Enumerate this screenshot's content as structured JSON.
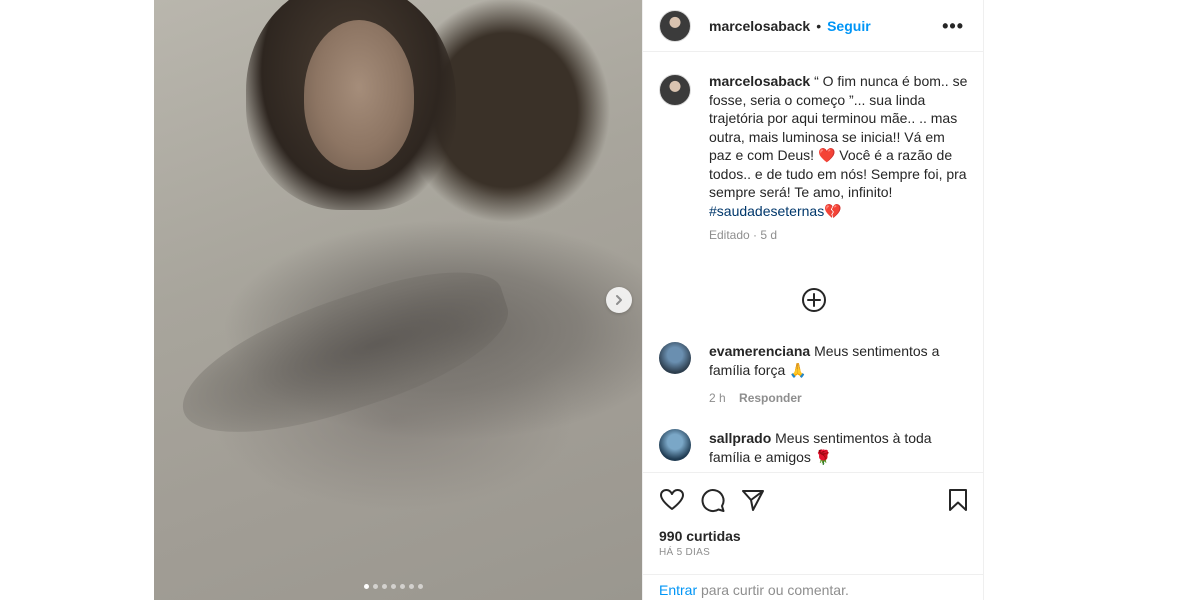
{
  "post": {
    "author": "marcelosaback",
    "follow_label": "Seguir",
    "separator": "•",
    "more_label": "•••",
    "caption": {
      "text": "“ O fim nunca é bom.. se fosse, seria o começo ”... sua linda trajetória por aqui terminou mãe.. .. mas outra, mais luminosa se inicia!! Vá em paz e com Deus! ❤️ Você é a razão de todos.. e de tudo em nós! Sempre foi, pra sempre será! Te amo, infinito!",
      "hashtag": "#saudadeseternas",
      "hashtag_emoji": "💔",
      "meta": "Editado · 5 d"
    },
    "comments": [
      {
        "user": "evamerenciana",
        "text": "Meus sentimentos a família força 🙏",
        "time": "2 h",
        "reply_label": "Responder",
        "avatar_color": "#3e5a7a"
      },
      {
        "user": "sallprado",
        "text": "Meus sentimentos à toda família e amigos 🌹",
        "avatar_color": "#2f5f86"
      }
    ],
    "likes": "990 curtidas",
    "date": "HÁ 5 DIAS",
    "login": {
      "link": "Entrar",
      "text": " para curtir ou comentar."
    },
    "carousel": {
      "slide_count": 7,
      "active_index": 0
    }
  }
}
